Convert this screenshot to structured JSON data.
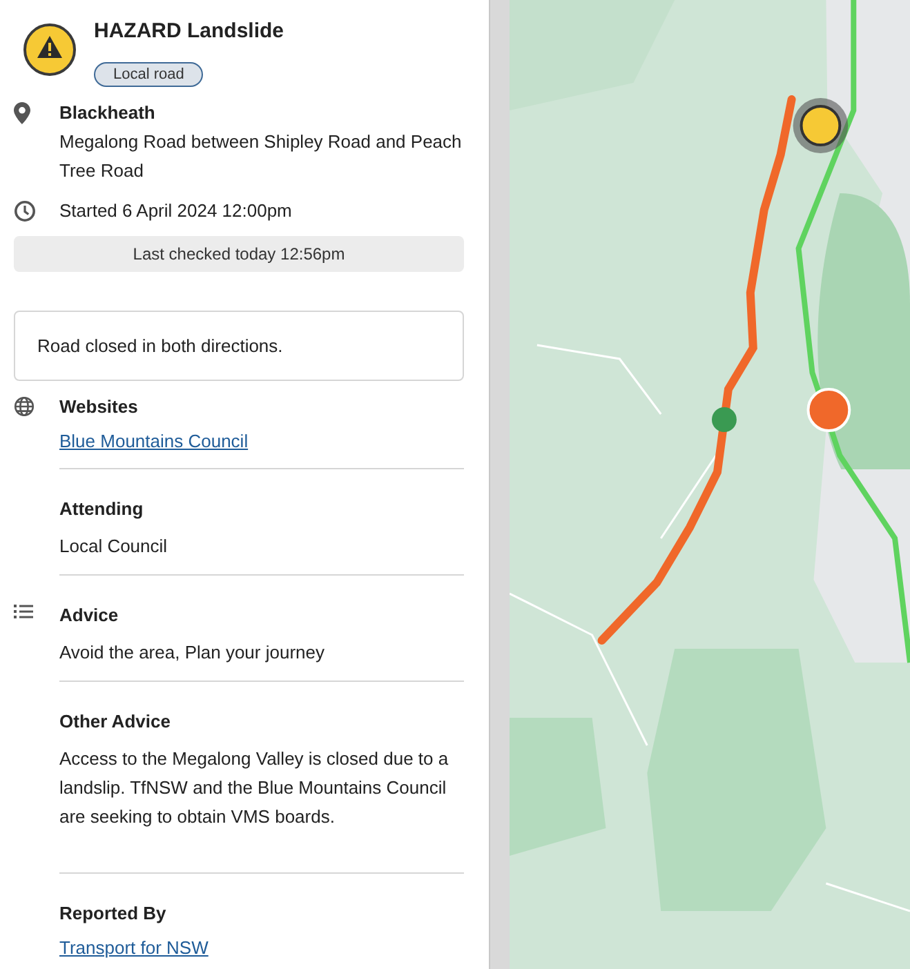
{
  "incident": {
    "title": "HAZARD Landslide",
    "tag": "Local road"
  },
  "location": {
    "suburb": "Blackheath",
    "description": "Megalong Road between Shipley Road and Peach Tree Road"
  },
  "started": "Started 6 April 2024 12:00pm",
  "last_checked": "Last checked today 12:56pm",
  "notice": "Road closed in both directions.",
  "sections": [
    {
      "kind": "websites",
      "heading": "Websites",
      "link": "Blue Mountains Council"
    },
    {
      "kind": "plain",
      "heading": "Attending",
      "text": "Local Council"
    },
    {
      "kind": "advice",
      "heading": "Advice",
      "text": "Avoid the area, Plan your journey"
    },
    {
      "kind": "plain",
      "heading": "Other Advice",
      "text": "Access to the Megalong Valley is closed due to a landslip. TfNSW and the Blue Mountains Council are seeking to obtain VMS boards."
    },
    {
      "kind": "plain",
      "heading": "Reported By",
      "link": "Transport for NSW"
    }
  ]
}
